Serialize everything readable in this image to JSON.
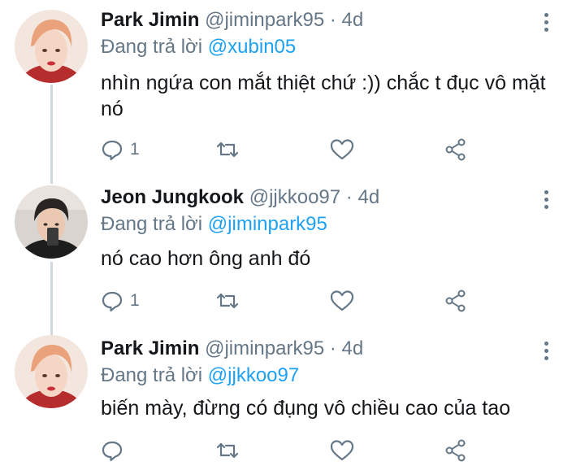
{
  "tweets": [
    {
      "name": "Park Jimin",
      "handle": "@jiminpark95",
      "dot": "·",
      "time": "4d",
      "reply_prefix": "Đang trả lời",
      "reply_to": "@xubin05",
      "text": "nhìn ngứa con mắt thiệt chứ :)) chắc t đục vô mặt nó",
      "reply_count": "1",
      "avatar_icon": "person-photo-redhair",
      "colors": {
        "hair": "#e9a27a",
        "shirt": "#b62d2d"
      }
    },
    {
      "name": "Jeon Jungkook",
      "handle": "@jjkkoo97",
      "dot": "·",
      "time": "4d",
      "reply_prefix": "Đang trả lời",
      "reply_to": "@jiminpark95",
      "text": "nó cao hơn ông anh đó",
      "reply_count": "1",
      "avatar_icon": "person-photo-darkhair",
      "colors": {
        "hair": "#2a2522",
        "shirt": "#1d1d1d"
      }
    },
    {
      "name": "Park Jimin",
      "handle": "@jiminpark95",
      "dot": "·",
      "time": "4d",
      "reply_prefix": "Đang trả lời",
      "reply_to": "@jjkkoo97",
      "text": "biến mày, đừng có đụng vô chiều cao của tao",
      "reply_count": "",
      "avatar_icon": "person-photo-redhair",
      "colors": {
        "hair": "#e9a27a",
        "shirt": "#b62d2d"
      }
    }
  ],
  "icons": [
    "reply-icon",
    "retweet-icon",
    "like-icon",
    "share-icon",
    "more-icon"
  ],
  "theme": {
    "link": "#1da1f2",
    "secondary": "#657786",
    "text": "#14171a"
  }
}
